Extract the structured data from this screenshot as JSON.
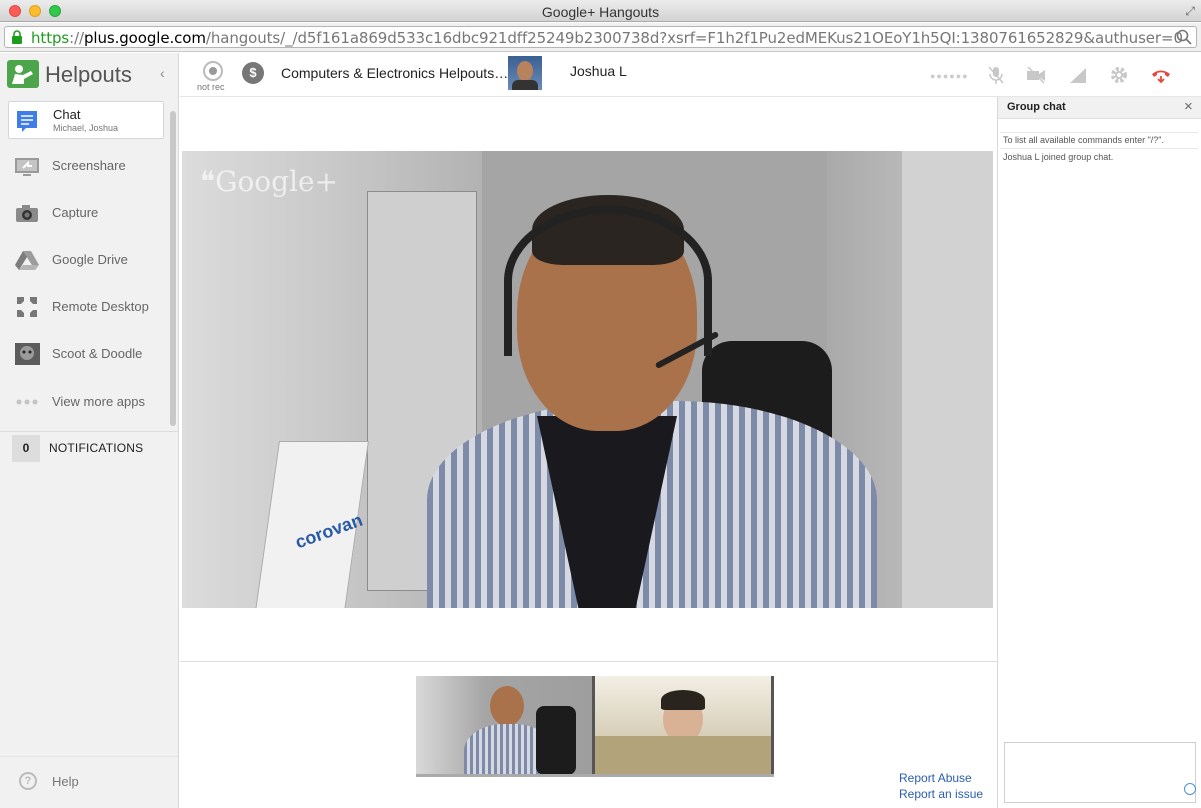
{
  "window": {
    "title": "Google+ Hangouts"
  },
  "urlbar": {
    "scheme": "https",
    "separator": "://",
    "host": "plus.google.com",
    "path": "/hangouts/_/d5f161a869d533c16dbc921dff25249b2300738d?xsrf=F1h2f1Pu2edMEKus21OEoY1h5QI:1380761652829&authuser=0"
  },
  "sidebar": {
    "brand": "Helpouts",
    "items": [
      {
        "label": "Chat",
        "sub": "Michael, Joshua",
        "icon": "chat-icon",
        "active": true
      },
      {
        "label": "Screenshare",
        "icon": "screenshare-icon"
      },
      {
        "label": "Capture",
        "icon": "camera-icon"
      },
      {
        "label": "Google Drive",
        "icon": "google-drive-icon"
      },
      {
        "label": "Remote Desktop",
        "icon": "remote-desktop-icon"
      },
      {
        "label": "Scoot & Doodle",
        "icon": "scoot-doodle-icon"
      },
      {
        "label": "View more apps",
        "icon": "more-dots-icon"
      }
    ],
    "notifications": {
      "count": "0",
      "label": "NOTIFICATIONS"
    },
    "help": "Help"
  },
  "callbar": {
    "rec_label": "not rec",
    "dollar": "$",
    "title": "Computers & Electronics Helpouts…",
    "participant": "Joshua L"
  },
  "stage": {
    "watermark": "Google+",
    "box_brand": "corovan"
  },
  "footer": {
    "report_abuse": "Report Abuse",
    "report_issue": "Report an issue"
  },
  "chat": {
    "title": "Group chat",
    "close": "×",
    "messages": [
      "To list all available commands enter \"/?\".",
      "Joshua L joined group chat."
    ],
    "input_value": ""
  },
  "colors": {
    "brand_green": "#4ca44b",
    "hangup_red": "#e8453c",
    "link_blue": "#2a5db0",
    "url_https": "#1e9c1e"
  }
}
